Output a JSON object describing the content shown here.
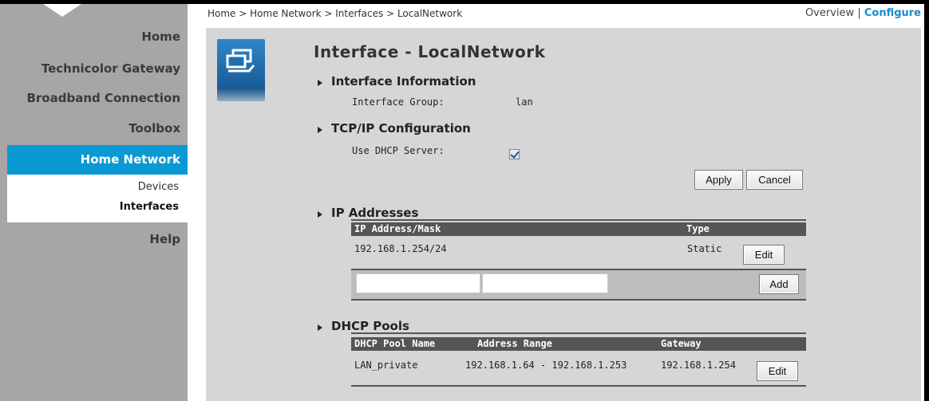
{
  "nav": {
    "items": [
      {
        "label": "Home"
      },
      {
        "label": "Technicolor Gateway"
      },
      {
        "label": "Broadband Connection"
      },
      {
        "label": "Toolbox"
      },
      {
        "label": "Home Network"
      },
      {
        "label": "Help"
      }
    ],
    "sub": [
      {
        "label": "Devices"
      },
      {
        "label": "Interfaces"
      }
    ]
  },
  "breadcrumb": {
    "parts": [
      "Home",
      "Home Network",
      "Interfaces",
      "LocalNetwork"
    ],
    "separator": ">"
  },
  "toplinks": {
    "overview": "Overview",
    "sep": "|",
    "configure": "Configure"
  },
  "page": {
    "title": "Interface - LocalNetwork",
    "icon": "network-interface-icon"
  },
  "interface_info": {
    "heading": "Interface Information",
    "group_label": "Interface Group:",
    "group_value": "lan"
  },
  "tcpip": {
    "heading": "TCP/IP Configuration",
    "dhcp_label": "Use DHCP Server:",
    "dhcp_checked": true
  },
  "buttons": {
    "apply": "Apply",
    "cancel": "Cancel",
    "edit": "Edit",
    "add": "Add"
  },
  "ip_addresses": {
    "heading": "IP Addresses",
    "columns": [
      "IP Address/Mask",
      "Type"
    ],
    "rows": [
      {
        "address": "192.168.1.254/24",
        "type": "Static"
      }
    ],
    "new_address": "",
    "new_mask": ""
  },
  "dhcp_pools": {
    "heading": "DHCP Pools",
    "columns": [
      "DHCP Pool Name",
      "Address Range",
      "Gateway"
    ],
    "rows": [
      {
        "name": "LAN_private",
        "range": "192.168.1.64 - 192.168.1.253",
        "gateway": "192.168.1.254"
      }
    ]
  },
  "colors": {
    "accent": "#0b99d3",
    "sidebar": "#a6a6a6",
    "panel": "#d6d6d6",
    "table_header": "#555555"
  }
}
